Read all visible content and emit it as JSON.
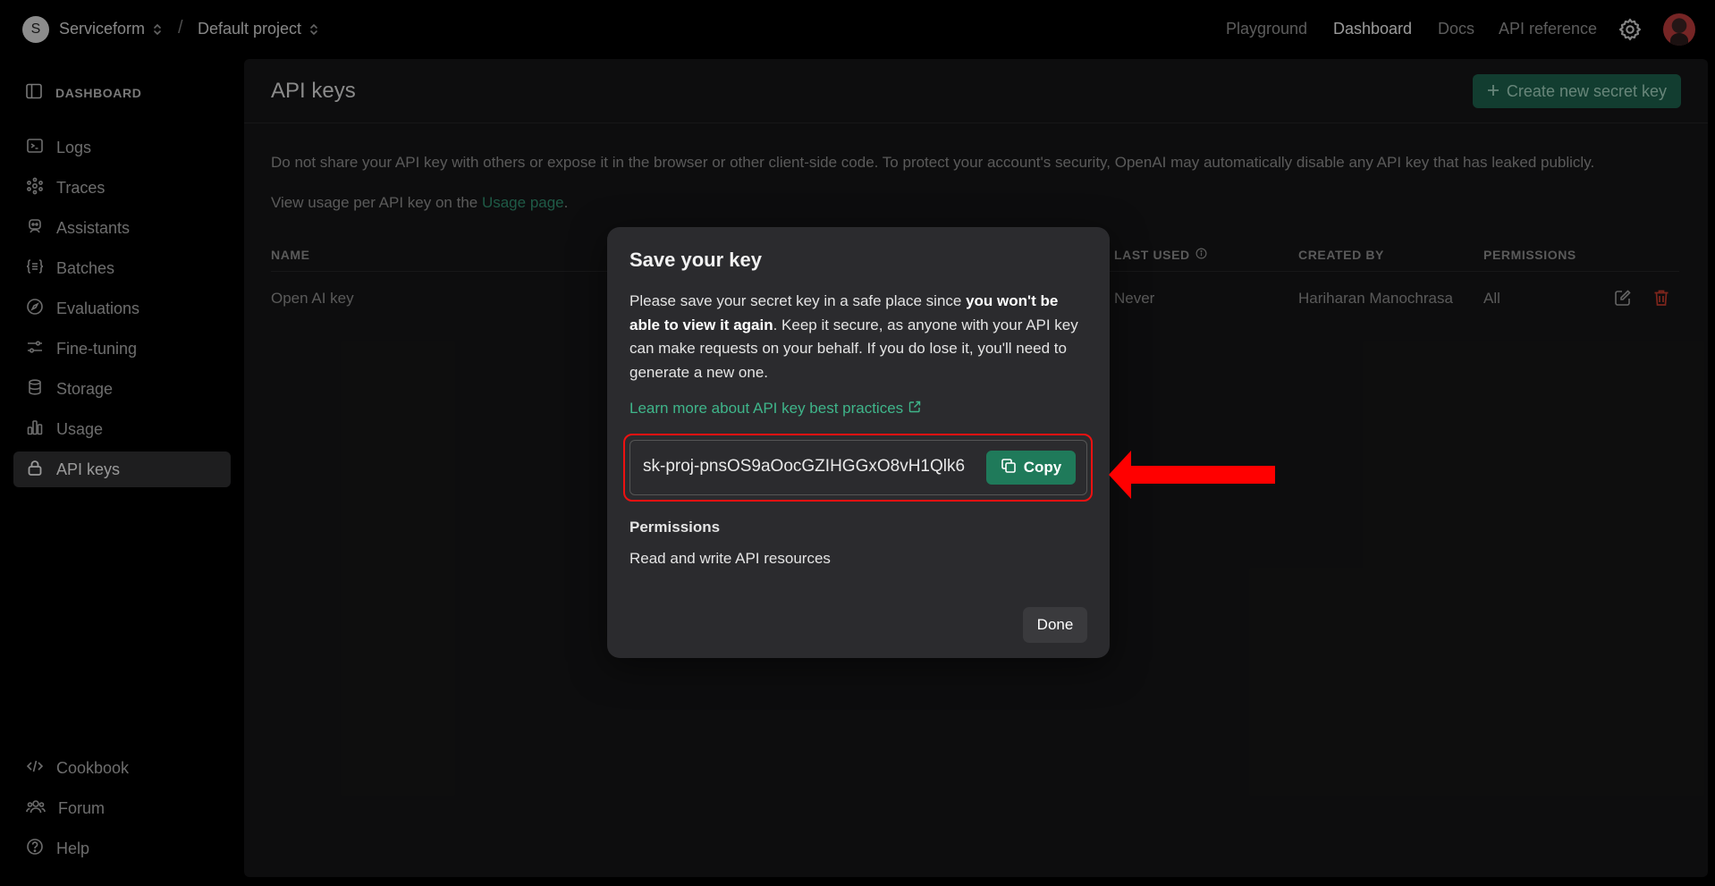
{
  "header": {
    "org_initial": "S",
    "org_name": "Serviceform",
    "separator": "/",
    "project_name": "Default project",
    "nav": [
      "Playground",
      "Dashboard",
      "Docs",
      "API reference"
    ],
    "active_nav": "Dashboard"
  },
  "sidebar": {
    "section_label": "DASHBOARD",
    "items": [
      {
        "label": "Logs",
        "icon": "terminal-icon"
      },
      {
        "label": "Traces",
        "icon": "traces-icon"
      },
      {
        "label": "Assistants",
        "icon": "robot-icon"
      },
      {
        "label": "Batches",
        "icon": "batches-icon"
      },
      {
        "label": "Evaluations",
        "icon": "compass-icon"
      },
      {
        "label": "Fine-tuning",
        "icon": "sliders-icon"
      },
      {
        "label": "Storage",
        "icon": "database-icon"
      },
      {
        "label": "Usage",
        "icon": "bar-chart-icon"
      },
      {
        "label": "API keys",
        "icon": "lock-icon"
      }
    ],
    "active_item": "API keys",
    "bottom": [
      {
        "label": "Cookbook",
        "icon": "code-icon"
      },
      {
        "label": "Forum",
        "icon": "people-icon"
      },
      {
        "label": "Help",
        "icon": "help-icon"
      }
    ]
  },
  "main": {
    "title": "API keys",
    "create_button": "Create new secret key",
    "warning": "Do not share your API key with others or expose it in the browser or other client-side code. To protect your account's security, OpenAI may automatically disable any API key that has leaked publicly.",
    "usage_prefix": "View usage per API key on the ",
    "usage_link": "Usage page",
    "usage_suffix": ".",
    "table": {
      "columns": [
        "NAME",
        "LAST USED",
        "CREATED BY",
        "PERMISSIONS"
      ],
      "rows": [
        {
          "name": "Open AI key",
          "last_used": "Never",
          "created_by": "Hariharan Manochrasa",
          "permissions": "All"
        }
      ]
    }
  },
  "modal": {
    "title": "Save your key",
    "body_1": "Please save your secret key in a safe place since ",
    "body_bold": "you won't be able to view it again",
    "body_2": ". Keep it secure, as anyone with your API key can make requests on your behalf. If you do lose it, you'll need to generate a new one.",
    "learn_link": "Learn more about API key best practices",
    "key_value": "sk-proj-pnsOS9aOocGZIHGGxO8vH1Qlk6",
    "copy_label": "Copy",
    "permissions_title": "Permissions",
    "permissions_value": "Read and write API resources",
    "done_label": "Done"
  },
  "colors": {
    "accent_green": "#1f7a5a",
    "link_green": "#3fb58a",
    "delete_red": "#c0392b",
    "highlight_red": "#e11111"
  }
}
